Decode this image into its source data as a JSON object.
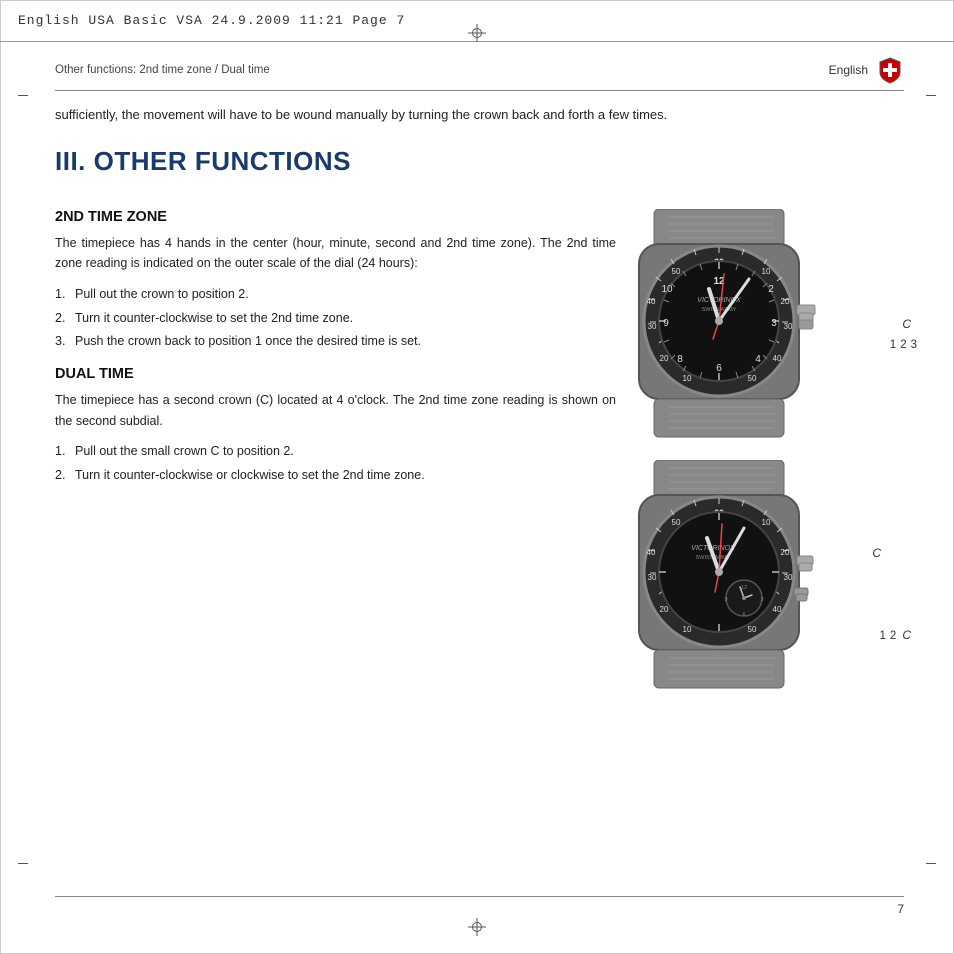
{
  "page": {
    "top_bar_text": "English USA Basic VSA   24.9.2009   11:21   Page 7",
    "header_breadcrumb": "Other functions: 2nd time zone / Dual time",
    "header_english": "English",
    "page_number": "7",
    "intro_text": "sufficiently, the movement will have to be wound manually by turning the crown back and forth a few times.",
    "section_title": "III. OTHER FUNCTIONS",
    "section_2nd_time_zone": {
      "title": "2ND TIME ZONE",
      "body": "The timepiece has 4 hands in the center (hour, minute, second and 2nd time zone). The 2nd time zone reading is indicated on the outer scale of the dial (24 hours):",
      "steps": [
        {
          "num": "1.",
          "text": "Pull out the crown to position 2."
        },
        {
          "num": "2.",
          "text": "Turn it counter-clockwise to set the 2nd time zone."
        },
        {
          "num": "3.",
          "text": "Push the crown back to position 1 once the desired time is set."
        }
      ]
    },
    "section_dual_time": {
      "title": "DUAL TIME",
      "body1": "The timepiece has a second crown (C) located at 4 o'clock. The 2nd time zone reading is shown on the second subdial.",
      "steps": [
        {
          "num": "1.",
          "text": "Pull out the small crown C to position 2."
        },
        {
          "num": "2.",
          "text": "Turn it counter-clockwise or clockwise to set the 2nd time zone."
        }
      ]
    },
    "watch1_labels": {
      "crown_label": "C",
      "pos1": "1",
      "pos2": "2",
      "pos3": "3"
    },
    "watch2_labels": {
      "crown_label_top": "C",
      "crown_label_side": "C",
      "pos1": "1",
      "pos2": "2"
    }
  }
}
